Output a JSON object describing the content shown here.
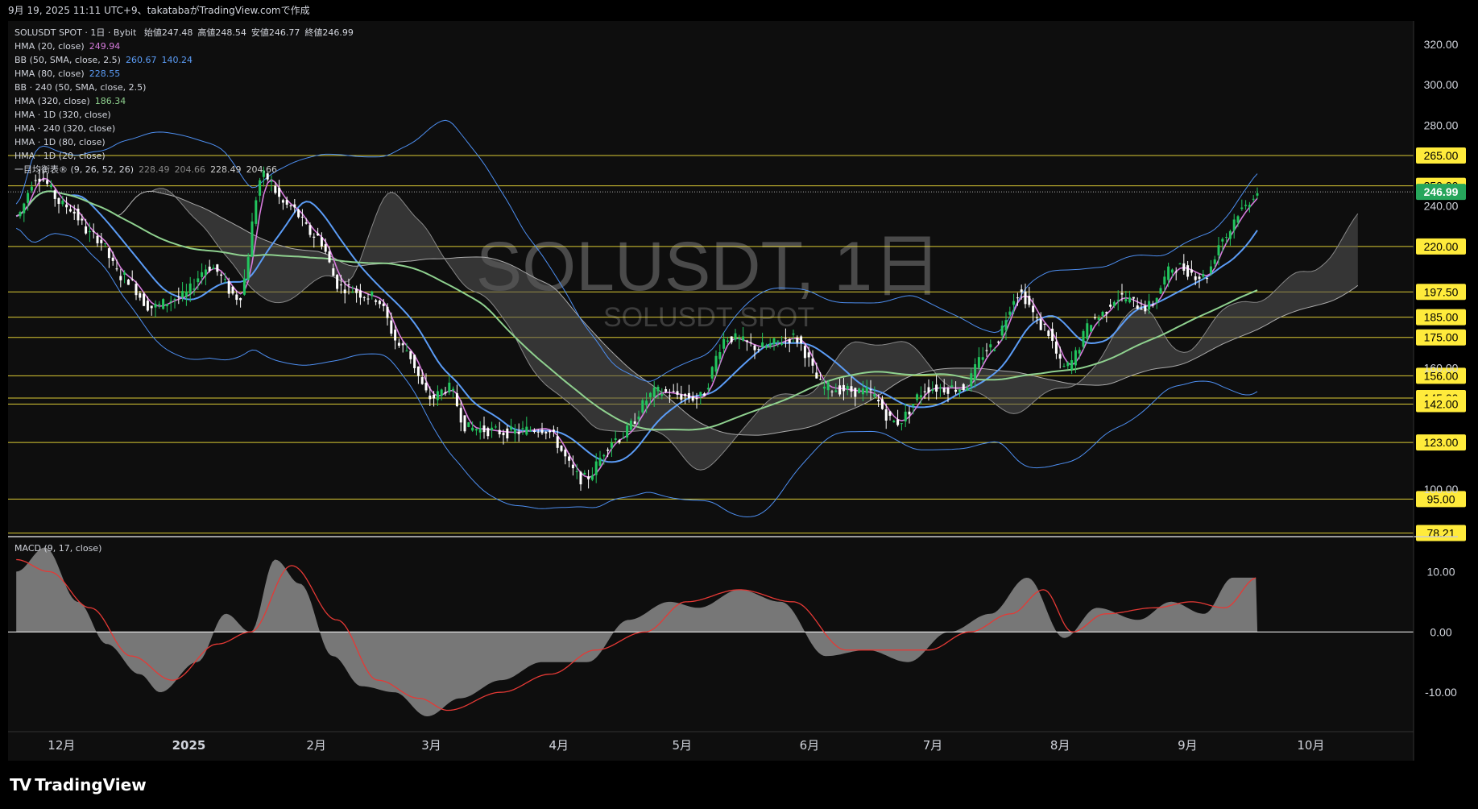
{
  "header": {
    "created": "9月 19, 2025 11:11 UTC+9、takatabaがTradingView.comで作成"
  },
  "watermark": {
    "main": "SOLUSDT, 1日",
    "sub": "SOLUSDT SPOT"
  },
  "logo": {
    "text": "TradingView"
  },
  "legend": {
    "symbol": "SOLUSDT SPOT · 1日 · Bybit",
    "ohlc": [
      {
        "label": "始値",
        "value": "247.48"
      },
      {
        "label": "高値",
        "value": "248.54"
      },
      {
        "label": "安値",
        "value": "246.77"
      },
      {
        "label": "終値",
        "value": "246.99"
      }
    ],
    "indicators": [
      {
        "name": "HMA (20, close)",
        "values": [
          "249.94"
        ],
        "colors": [
          "#d67bdc"
        ]
      },
      {
        "name": "BB (50, SMA, close, 2.5)",
        "values": [
          "260.67",
          "140.24"
        ],
        "colors": [
          "#5b9cf6",
          "#5b9cf6"
        ]
      },
      {
        "name": "HMA (80, close)",
        "values": [
          "228.55"
        ],
        "colors": [
          "#5b9cf6"
        ]
      },
      {
        "name": "BB · 240 (50, SMA, close, 2.5)",
        "values": [],
        "colors": []
      },
      {
        "name": "HMA (320, close)",
        "values": [
          "186.34"
        ],
        "colors": [
          "#8fd18f"
        ]
      },
      {
        "name": "HMA · 1D (320, close)",
        "values": [],
        "colors": []
      },
      {
        "name": "HMA · 240 (320, close)",
        "values": [],
        "colors": []
      },
      {
        "name": "HMA · 1D (80, close)",
        "values": [],
        "colors": []
      },
      {
        "name": "HMA · 1D (20, close)",
        "values": [],
        "colors": []
      },
      {
        "name": "一目均衡表® (9, 26, 52, 26)",
        "values": [
          "228.49",
          "204.66",
          "228.49",
          "204.66"
        ],
        "colors": [
          "#888888",
          "#888888",
          "#cccccc",
          "#cccccc"
        ]
      }
    ],
    "macd": "MACD (9, 17, close)"
  },
  "chart_data": [
    {
      "type": "candlestick",
      "title": "SOLUSDT, 1日",
      "y_axis_ticks": [
        "100.00",
        "160.00",
        "240.00",
        "280.00",
        "300.00",
        "320.00"
      ],
      "price_levels": [
        "265.00",
        "250.00",
        "220.00",
        "197.50",
        "185.00",
        "175.00",
        "156.00",
        "145.00",
        "142.00",
        "123.00",
        "95.00",
        "78.21"
      ],
      "last_price": "246.99",
      "level_color": "#ffeb3b",
      "x_axis_labels": [
        "12月",
        "2025",
        "2月",
        "3月",
        "4月",
        "5月",
        "6月",
        "7月",
        "8月",
        "9月",
        "10月"
      ],
      "ylim": [
        78,
        330
      ],
      "close_path": [
        [
          "2024-11-20",
          235
        ],
        [
          "2024-11-25",
          255
        ],
        [
          "2024-12-02",
          240
        ],
        [
          "2024-12-09",
          225
        ],
        [
          "2024-12-16",
          205
        ],
        [
          "2024-12-23",
          190
        ],
        [
          "2024-12-30",
          195
        ],
        [
          "2025-01-06",
          210
        ],
        [
          "2025-01-13",
          195
        ],
        [
          "2025-01-19",
          255
        ],
        [
          "2025-01-25",
          240
        ],
        [
          "2025-02-01",
          225
        ],
        [
          "2025-02-07",
          200
        ],
        [
          "2025-02-15",
          195
        ],
        [
          "2025-02-22",
          170
        ],
        [
          "2025-03-01",
          145
        ],
        [
          "2025-03-05",
          150
        ],
        [
          "2025-03-10",
          130
        ],
        [
          "2025-03-20",
          128
        ],
        [
          "2025-03-28",
          130
        ],
        [
          "2025-04-07",
          105
        ],
        [
          "2025-04-15",
          125
        ],
        [
          "2025-04-25",
          148
        ],
        [
          "2025-05-05",
          145
        ],
        [
          "2025-05-12",
          175
        ],
        [
          "2025-05-20",
          170
        ],
        [
          "2025-05-28",
          175
        ],
        [
          "2025-06-05",
          150
        ],
        [
          "2025-06-15",
          148
        ],
        [
          "2025-06-22",
          133
        ],
        [
          "2025-06-30",
          150
        ],
        [
          "2025-07-08",
          150
        ],
        [
          "2025-07-15",
          170
        ],
        [
          "2025-07-22",
          197
        ],
        [
          "2025-07-28",
          180
        ],
        [
          "2025-08-02",
          160
        ],
        [
          "2025-08-10",
          185
        ],
        [
          "2025-08-15",
          195
        ],
        [
          "2025-08-22",
          190
        ],
        [
          "2025-08-29",
          210
        ],
        [
          "2025-09-05",
          205
        ],
        [
          "2025-09-10",
          225
        ],
        [
          "2025-09-14",
          238
        ],
        [
          "2025-09-18",
          247
        ]
      ]
    },
    {
      "type": "area",
      "title": "MACD (9, 17, close)",
      "y_axis_ticks": [
        "10.00",
        "0.00",
        "-10.00"
      ],
      "ylim": [
        -16,
        15
      ],
      "hist": [
        [
          "2024-11-20",
          10
        ],
        [
          "2024-11-27",
          14
        ],
        [
          "2024-12-05",
          5
        ],
        [
          "2024-12-12",
          -2
        ],
        [
          "2024-12-20",
          -7
        ],
        [
          "2024-12-25",
          -10
        ],
        [
          "2025-01-03",
          -5
        ],
        [
          "2025-01-10",
          3
        ],
        [
          "2025-01-16",
          0
        ],
        [
          "2025-01-22",
          12
        ],
        [
          "2025-01-28",
          8
        ],
        [
          "2025-02-05",
          -4
        ],
        [
          "2025-02-12",
          -9
        ],
        [
          "2025-02-20",
          -10
        ],
        [
          "2025-02-28",
          -14
        ],
        [
          "2025-03-08",
          -11
        ],
        [
          "2025-03-18",
          -8
        ],
        [
          "2025-03-28",
          -5
        ],
        [
          "2025-04-08",
          -5
        ],
        [
          "2025-04-18",
          2
        ],
        [
          "2025-04-28",
          5
        ],
        [
          "2025-05-05",
          4
        ],
        [
          "2025-05-15",
          7
        ],
        [
          "2025-05-25",
          5
        ],
        [
          "2025-06-05",
          -4
        ],
        [
          "2025-06-15",
          -3
        ],
        [
          "2025-06-25",
          -5
        ],
        [
          "2025-07-05",
          0
        ],
        [
          "2025-07-15",
          3
        ],
        [
          "2025-07-24",
          9
        ],
        [
          "2025-08-02",
          -1
        ],
        [
          "2025-08-10",
          4
        ],
        [
          "2025-08-20",
          2
        ],
        [
          "2025-08-28",
          5
        ],
        [
          "2025-09-05",
          3
        ],
        [
          "2025-09-12",
          9
        ],
        [
          "2025-09-18",
          9
        ]
      ],
      "signal": [
        [
          "2024-11-20",
          12
        ],
        [
          "2024-11-28",
          10
        ],
        [
          "2024-12-08",
          4
        ],
        [
          "2024-12-18",
          -4
        ],
        [
          "2024-12-28",
          -8
        ],
        [
          "2025-01-08",
          -2
        ],
        [
          "2025-01-16",
          0
        ],
        [
          "2025-01-26",
          11
        ],
        [
          "2025-02-06",
          2
        ],
        [
          "2025-02-16",
          -8
        ],
        [
          "2025-02-26",
          -11
        ],
        [
          "2025-03-05",
          -13
        ],
        [
          "2025-03-18",
          -10
        ],
        [
          "2025-03-30",
          -7
        ],
        [
          "2025-04-10",
          -3
        ],
        [
          "2025-04-22",
          0
        ],
        [
          "2025-05-02",
          5
        ],
        [
          "2025-05-15",
          7
        ],
        [
          "2025-05-28",
          5
        ],
        [
          "2025-06-10",
          -3
        ],
        [
          "2025-06-20",
          -3
        ],
        [
          "2025-06-30",
          -3
        ],
        [
          "2025-07-10",
          0
        ],
        [
          "2025-07-20",
          3
        ],
        [
          "2025-07-28",
          7
        ],
        [
          "2025-08-04",
          0
        ],
        [
          "2025-08-12",
          3
        ],
        [
          "2025-08-24",
          4
        ],
        [
          "2025-09-02",
          5
        ],
        [
          "2025-09-10",
          4
        ],
        [
          "2025-09-18",
          9
        ]
      ]
    }
  ]
}
